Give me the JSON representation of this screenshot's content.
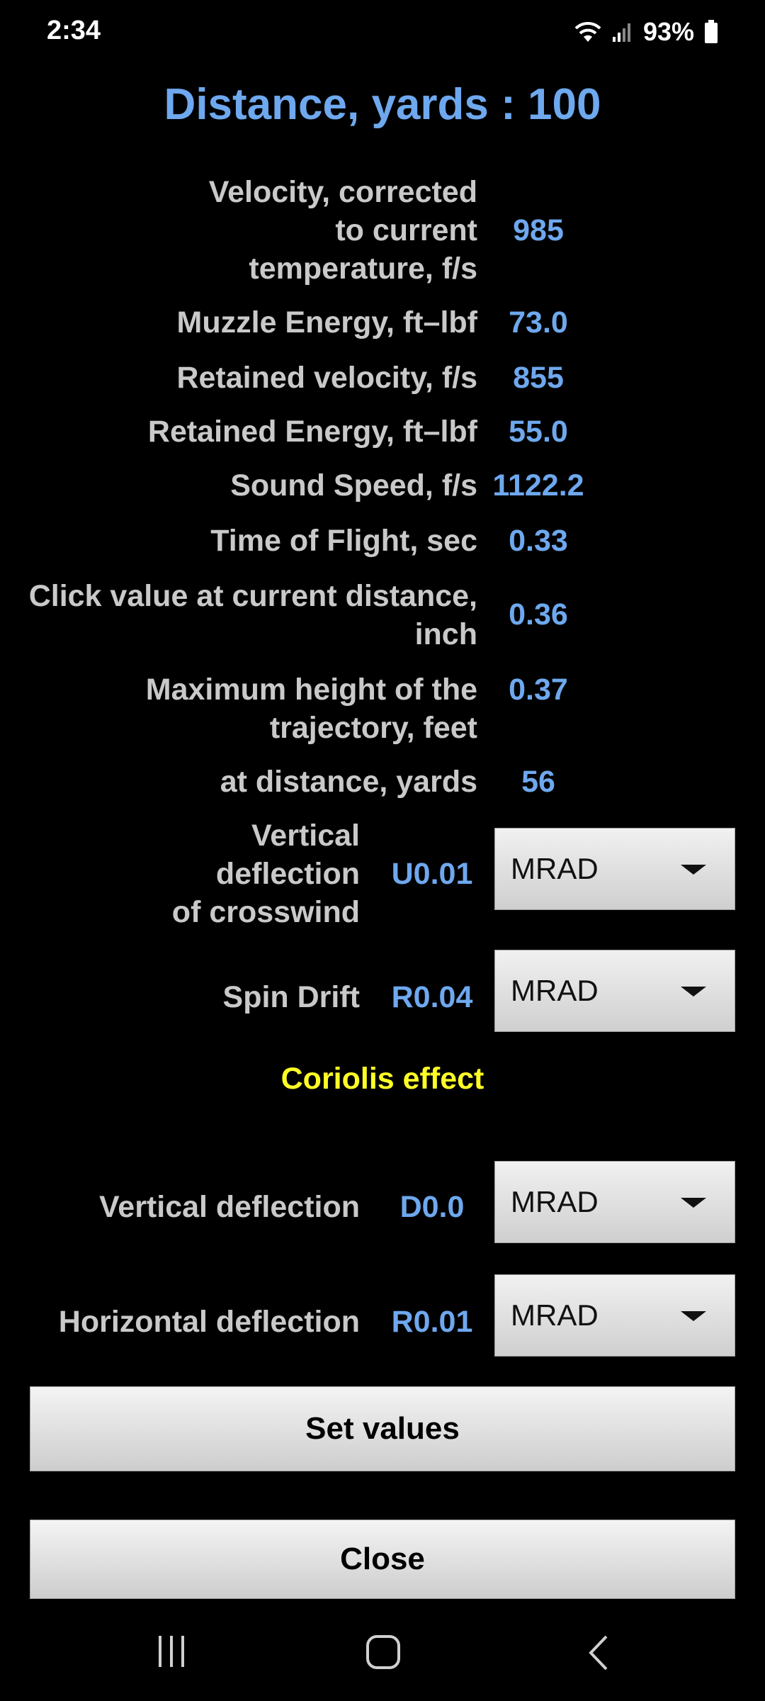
{
  "status_bar": {
    "time": "2:34",
    "battery": "93%"
  },
  "title": "Distance, yards : 100",
  "rows": [
    {
      "label": "Velocity, corrected\nto current\ntemperature, f/s",
      "value": "985"
    },
    {
      "label": "Muzzle Energy, ft–lbf",
      "value": "73.0"
    },
    {
      "label": "Retained velocity, f/s",
      "value": "855"
    },
    {
      "label": "Retained Energy, ft–lbf",
      "value": "55.0"
    },
    {
      "label": "Sound Speed, f/s",
      "value": "1122.2"
    },
    {
      "label": "Time of Flight, sec",
      "value": "0.33"
    },
    {
      "label": "Click value at current distance,\ninch",
      "value": "0.36"
    },
    {
      "label": "Maximum height of the\ntrajectory, feet",
      "value": "0.37"
    },
    {
      "label": "at distance, yards",
      "value": "56"
    }
  ],
  "vertical_crosswind": {
    "label": "Vertical\ndeflection\nof crosswind",
    "value": "U0.01",
    "unit": "MRAD"
  },
  "spin_drift": {
    "label": "Spin Drift",
    "value": "R0.04",
    "unit": "MRAD"
  },
  "coriolis": {
    "label": "Coriolis effect",
    "vertical": {
      "label": "Vertical deflection",
      "value": "D0.0",
      "unit": "MRAD"
    },
    "horizontal": {
      "label": "Horizontal deflection",
      "value": "R0.01",
      "unit": "MRAD"
    }
  },
  "buttons": {
    "set_values": "Set values",
    "close": "Close"
  },
  "colors": {
    "accent_blue": "#6ea8ee",
    "label_gray": "#c9c9c9",
    "coriolis_yellow": "#ffff26",
    "background": "#000000"
  }
}
